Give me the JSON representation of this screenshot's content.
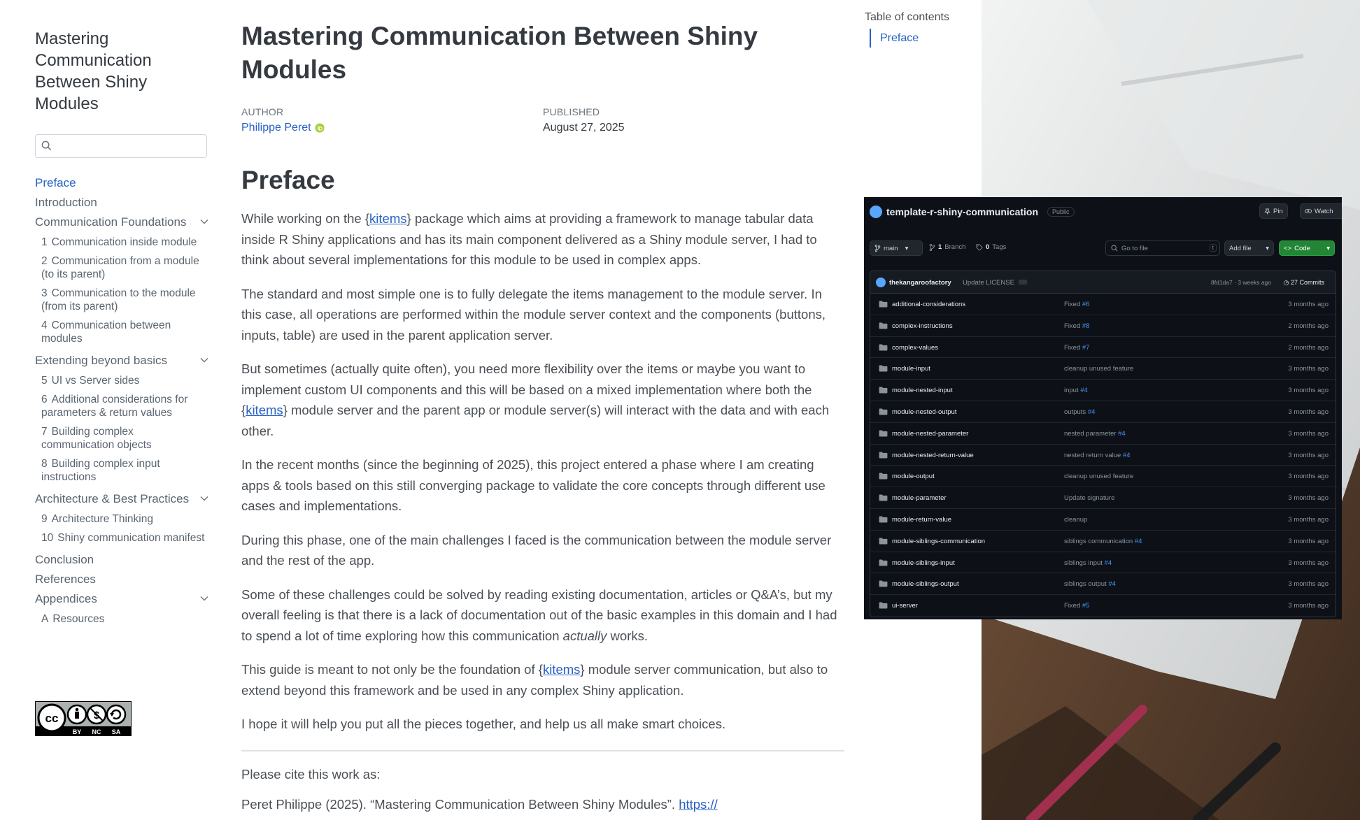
{
  "sidebar": {
    "site_title": "Mastering Communication Between Shiny Modules",
    "search_placeholder": "",
    "nav": [
      {
        "label": "Preface",
        "active": true
      },
      {
        "label": "Introduction"
      },
      {
        "label": "Communication Foundations",
        "expandable": true,
        "children": [
          {
            "num": "1",
            "label": "Communication inside module"
          },
          {
            "num": "2",
            "label": "Communication from a module (to its parent)"
          },
          {
            "num": "3",
            "label": "Communication to the module (from its parent)"
          },
          {
            "num": "4",
            "label": "Communication between modules"
          }
        ]
      },
      {
        "label": "Extending beyond basics",
        "expandable": true,
        "children": [
          {
            "num": "5",
            "label": "UI vs Server sides"
          },
          {
            "num": "6",
            "label": "Additional considerations for parameters & return values"
          },
          {
            "num": "7",
            "label": "Building complex communication objects"
          },
          {
            "num": "8",
            "label": "Building complex input instructions"
          }
        ]
      },
      {
        "label": "Architecture & Best Practices",
        "expandable": true,
        "children": [
          {
            "num": "9",
            "label": "Architecture Thinking"
          },
          {
            "num": "10",
            "label": "Shiny communication manifest"
          }
        ]
      },
      {
        "label": "Conclusion"
      },
      {
        "label": "References"
      },
      {
        "label": "Appendices",
        "expandable": true,
        "children": [
          {
            "num": "A",
            "label": "Resources"
          }
        ]
      }
    ],
    "license_badge": {
      "icon": "cc-by-nc-sa-badge",
      "labels": [
        "BY",
        "NC",
        "SA"
      ]
    }
  },
  "main": {
    "title": "Mastering Communication Between Shiny Modules",
    "author_label": "AUTHOR",
    "author_name": "Philippe Peret",
    "published_label": "PUBLISHED",
    "published_date": "August 27, 2025",
    "section_heading": "Preface",
    "paragraphs": [
      [
        {
          "t": "While working on the {"
        },
        {
          "t": "kitems",
          "link": true
        },
        {
          "t": "} package which aims at providing a framework to manage tabular data inside R Shiny applications and has its main component delivered as a Shiny module server, I had to think about several implementations for this module to be used in complex apps."
        }
      ],
      [
        {
          "t": "The standard and most simple one is to fully delegate the items management to the module server. In this case, all operations are performed within the module server context and the components (buttons, inputs, table) are used in the parent application server."
        }
      ],
      [
        {
          "t": "But sometimes (actually quite often), you need more flexibility over the items or maybe you want to implement custom UI components and this will be based on a mixed implementation where both the {"
        },
        {
          "t": "kitems",
          "link": true
        },
        {
          "t": "} module server and the parent app or module server(s) will interact with the data and with each other."
        }
      ],
      [
        {
          "t": "In the recent months (since the beginning of 2025), this project entered a phase where I am creating apps & tools based on this still converging package to validate the core concepts through different use cases and implementations."
        }
      ],
      [
        {
          "t": "During this phase, one of the main challenges I faced is the communication between the module server and the rest of the app."
        }
      ],
      [
        {
          "t": "Some of these challenges could be solved by reading existing documentation, articles or Q&A’s, but my overall feeling is that there is a lack of documentation out of the basic examples in this domain and I had to spend a lot of time exploring how this communication "
        },
        {
          "t": "actually",
          "em": true
        },
        {
          "t": " works."
        }
      ],
      [
        {
          "t": "This guide is meant to not only be the foundation of {"
        },
        {
          "t": "kitems",
          "link": true
        },
        {
          "t": "} module server communication, but also to extend beyond this framework and be used in any complex Shiny application."
        }
      ],
      [
        {
          "t": "I hope it will help you put all the pieces together, and help us all make smart choices."
        }
      ]
    ],
    "cite_label": "Please cite this work as:",
    "cite_text": "Peret Philippe (2025). “Mastering Communication Between Shiny Modules”. ",
    "cite_link": "https://"
  },
  "right_toc": {
    "title": "Table of contents",
    "entries": [
      "Preface"
    ]
  },
  "github": {
    "repo_name": "template-r-shiny-communication",
    "visibility": "Public",
    "pin_label": "Pin",
    "watch_label": "Watch",
    "branch_label": "main",
    "branches_count": "1",
    "branches_label": "Branch",
    "tags_count": "0",
    "tags_label": "Tags",
    "goto_placeholder": "Go to file",
    "goto_kbd": "t",
    "add_file_label": "Add file",
    "code_label": "Code",
    "commit_user": "thekangaroofactory",
    "commit_message": "Update LICENSE",
    "commit_hash_time": "8fd1da7 · 3 weeks ago",
    "commit_count": "27 Commits",
    "files": [
      {
        "name": "additional-considerations",
        "msg": "Fixed ",
        "ref": "#6",
        "time": "3 months ago"
      },
      {
        "name": "complex-instructions",
        "msg": "Fixed ",
        "ref": "#8",
        "time": "2 months ago"
      },
      {
        "name": "complex-values",
        "msg": "Fixed ",
        "ref": "#7",
        "time": "2 months ago"
      },
      {
        "name": "module-input",
        "msg": "cleanup unused feature",
        "ref": "",
        "time": "3 months ago"
      },
      {
        "name": "module-nested-input",
        "msg": "input ",
        "ref": "#4",
        "time": "3 months ago"
      },
      {
        "name": "module-nested-output",
        "msg": "outputs ",
        "ref": "#4",
        "time": "3 months ago"
      },
      {
        "name": "module-nested-parameter",
        "msg": "nested parameter ",
        "ref": "#4",
        "time": "3 months ago"
      },
      {
        "name": "module-nested-return-value",
        "msg": "nested return value ",
        "ref": "#4",
        "time": "3 months ago"
      },
      {
        "name": "module-output",
        "msg": "cleanup unused feature",
        "ref": "",
        "time": "3 months ago"
      },
      {
        "name": "module-parameter",
        "msg": "Update signature",
        "ref": "",
        "time": "3 months ago"
      },
      {
        "name": "module-return-value",
        "msg": "cleanup",
        "ref": "",
        "time": "3 months ago"
      },
      {
        "name": "module-siblings-communication",
        "msg": "siblings communication ",
        "ref": "#4",
        "time": "3 months ago"
      },
      {
        "name": "module-siblings-input",
        "msg": "siblings input ",
        "ref": "#4",
        "time": "3 months ago"
      },
      {
        "name": "module-siblings-output",
        "msg": "siblings output ",
        "ref": "#4",
        "time": "3 months ago"
      },
      {
        "name": "ui-server",
        "msg": "Fixed ",
        "ref": "#5",
        "time": "3 months ago"
      }
    ]
  },
  "colors": {
    "link": "#2761c3",
    "text": "#343a40",
    "github_bg": "#0d1117",
    "github_code_btn": "#238636"
  }
}
